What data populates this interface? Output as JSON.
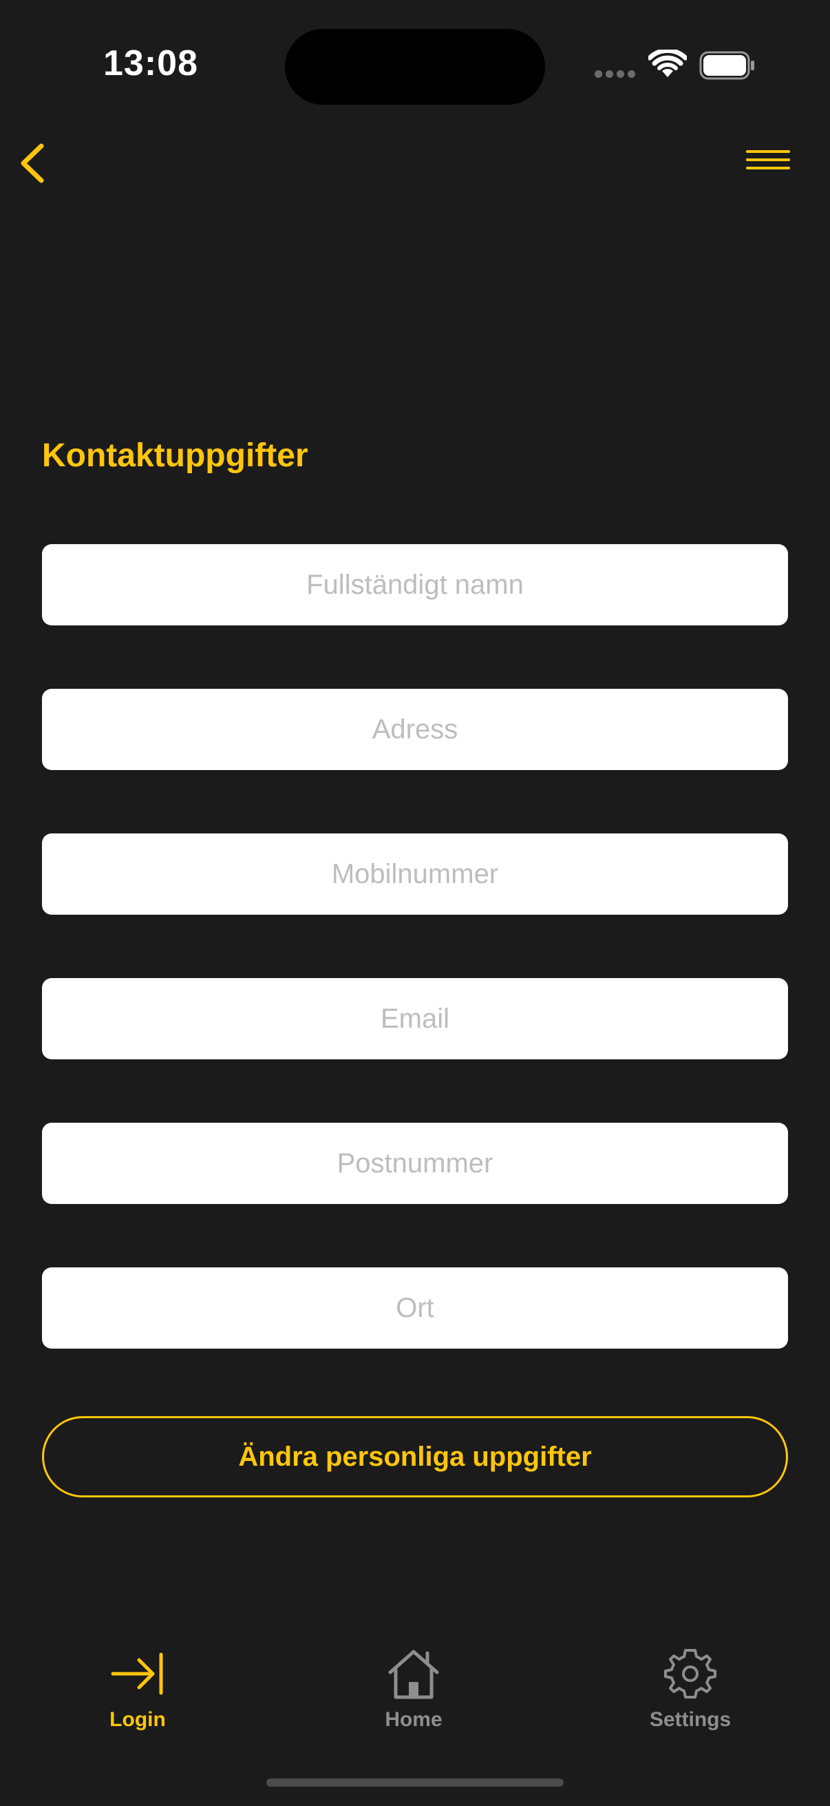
{
  "status_bar": {
    "time": "13:08"
  },
  "nav": {
    "back_icon": "chevron-left-icon",
    "menu_icon": "hamburger-menu-icon"
  },
  "section": {
    "title": "Kontaktuppgifter"
  },
  "form": {
    "fields": [
      {
        "name": "full-name",
        "value": "",
        "placeholder": "Fullständigt namn"
      },
      {
        "name": "address",
        "value": "",
        "placeholder": "Adress"
      },
      {
        "name": "mobile",
        "value": "",
        "placeholder": "Mobilnummer"
      },
      {
        "name": "email",
        "value": "",
        "placeholder": "Email"
      },
      {
        "name": "postal-code",
        "value": "",
        "placeholder": "Postnummer"
      },
      {
        "name": "city",
        "value": "",
        "placeholder": "Ort"
      }
    ],
    "submit_label": "Ändra personliga uppgifter"
  },
  "tabs": [
    {
      "label": "Login",
      "icon": "arrow-right-to-line-icon",
      "active": true
    },
    {
      "label": "Home",
      "icon": "home-icon",
      "active": false
    },
    {
      "label": "Settings",
      "icon": "gear-icon",
      "active": false
    }
  ],
  "colors": {
    "background": "#1b1b1b",
    "accent": "#ffc60b",
    "inactive": "#8e8e8e",
    "field_background": "#ffffff",
    "placeholder": "#bdbdbd"
  }
}
